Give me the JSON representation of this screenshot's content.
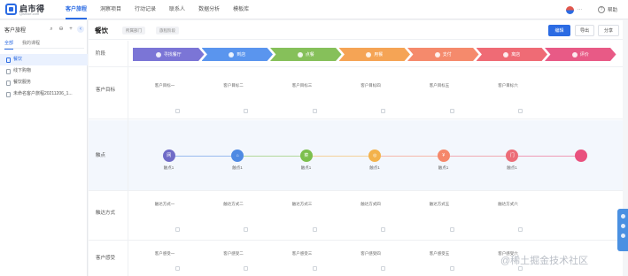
{
  "app": {
    "name": "启市得",
    "subtitle": "Qishide.com"
  },
  "nav": {
    "items": [
      "客户旅程",
      "洞察项目",
      "行动记录",
      "联系人",
      "数据分析",
      "模板库"
    ],
    "active_index": 0
  },
  "top_right": {
    "org_label": "···",
    "help_label": "帮助"
  },
  "sidebar": {
    "title": "客户旅程",
    "tabs": [
      "全部",
      "我的课程"
    ],
    "items": [
      {
        "label": "餐饮",
        "active": true
      },
      {
        "label": "线下购物",
        "active": false
      },
      {
        "label": "餐饮服务",
        "active": false
      },
      {
        "label": "未命名客户旅程20211206_1...",
        "active": false
      }
    ]
  },
  "main": {
    "title": "餐饮",
    "tags": [
      "所属部门",
      "旅程阶段"
    ],
    "buttons": {
      "primary": "编辑",
      "secondary": "导出",
      "tertiary": "分享"
    }
  },
  "rows": {
    "stage_label": "阶段",
    "goal_label": "客户目标",
    "touch_label": "触点",
    "contact_label": "触达方式",
    "feel_label": "客户感受"
  },
  "stages": [
    {
      "num": "1",
      "label": "寻找餐厅",
      "color": "#7b75d6"
    },
    {
      "num": "2",
      "label": "到店",
      "color": "#5a95ee"
    },
    {
      "num": "3",
      "label": "点餐",
      "color": "#86c05a"
    },
    {
      "num": "4",
      "label": "用餐",
      "color": "#f5a455"
    },
    {
      "num": "5",
      "label": "支付",
      "color": "#f58a6c"
    },
    {
      "num": "6",
      "label": "离店",
      "color": "#ef6b75"
    },
    {
      "num": "7",
      "label": "评价",
      "color": "#e85a86"
    }
  ],
  "goals": [
    "客户目标一",
    "客户目标二",
    "客户目标三",
    "客户目标四",
    "客户目标五",
    "客户目标六"
  ],
  "touchpoints": [
    {
      "label": "触点1",
      "icon": "网",
      "color": "#6f6bc7"
    },
    {
      "label": "触点1",
      "icon": "⌂",
      "color": "#4f8ae3"
    },
    {
      "label": "触点1",
      "icon": "菜",
      "color": "#7cbf4d"
    },
    {
      "label": "触点1",
      "icon": "◎",
      "color": "#f3b24b"
    },
    {
      "label": "触点1",
      "icon": "¥",
      "color": "#f5876a"
    },
    {
      "label": "触点1",
      "icon": "门",
      "color": "#ec6d78"
    },
    {
      "label": "",
      "icon": "",
      "color": "#e9517e"
    }
  ],
  "contact_methods": [
    "触达方式一",
    "触达方式二",
    "触达方式三",
    "触达方式四",
    "触达方式五",
    "触达方式六"
  ],
  "feelings": [
    "客户感受一",
    "客户感受二",
    "客户感受三",
    "客户感受四",
    "客户感受五",
    "客户感受六"
  ],
  "watermark": "@稀土掘金技术社区"
}
